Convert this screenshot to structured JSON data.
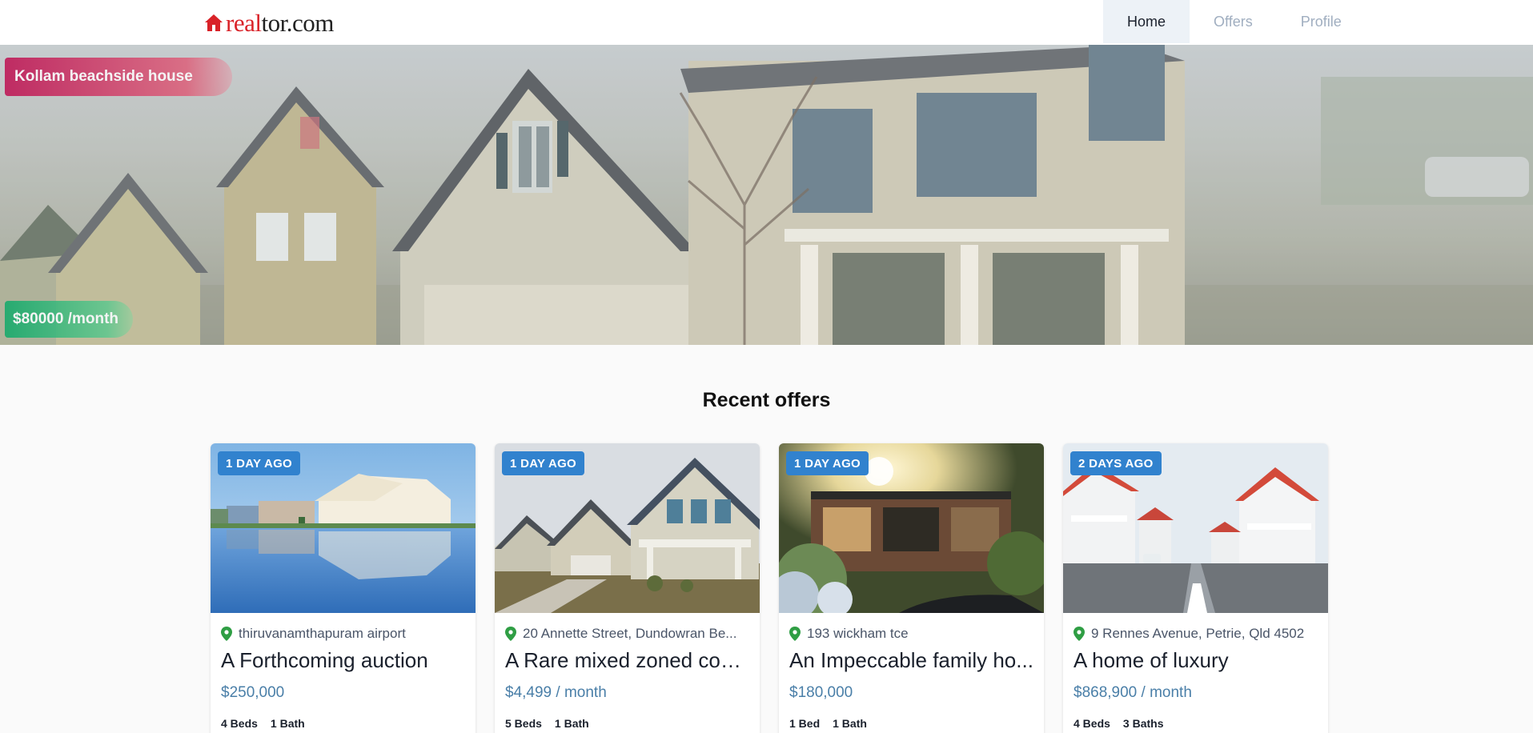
{
  "header": {
    "logo": {
      "part1": "real",
      "part2": "tor.com"
    },
    "nav": [
      {
        "label": "Home",
        "active": true
      },
      {
        "label": "Offers",
        "active": false
      },
      {
        "label": "Profile",
        "active": false
      }
    ]
  },
  "hero": {
    "title": "Kollam beachside house",
    "price": "$80000 /month",
    "title_badge_color": "#c41e5a",
    "price_badge_color": "#20aa6e"
  },
  "section": {
    "title": "Recent offers"
  },
  "listings": [
    {
      "badge": "1 DAY AGO",
      "location": "thiruvanamthapuram airport",
      "title": "A Forthcoming auction",
      "price": "$250,000",
      "beds": "4 Beds",
      "baths": "1 Bath"
    },
    {
      "badge": "1 DAY AGO",
      "location": "20 Annette Street, Dundowran Be...",
      "title": "A Rare mixed zoned com...",
      "price": "$4,499 / month",
      "beds": "5 Beds",
      "baths": "1 Bath"
    },
    {
      "badge": "1 DAY AGO",
      "location": "193 wickham tce",
      "title": "An Impeccable family ho...",
      "price": "$180,000",
      "beds": "1 Bed",
      "baths": "1 Bath"
    },
    {
      "badge": "2 DAYS AGO",
      "location": "9 Rennes Avenue, Petrie, Qld 4502",
      "title": "A home of luxury",
      "price": "$868,900 / month",
      "beds": "4 Beds",
      "baths": "3 Baths"
    }
  ],
  "icons": {
    "logo": "house-icon",
    "location": "map-pin-icon"
  },
  "colors": {
    "accent": "#3182ce",
    "brand": "#d92228",
    "pin": "#2f9e44",
    "price": "#4a7fa8"
  }
}
